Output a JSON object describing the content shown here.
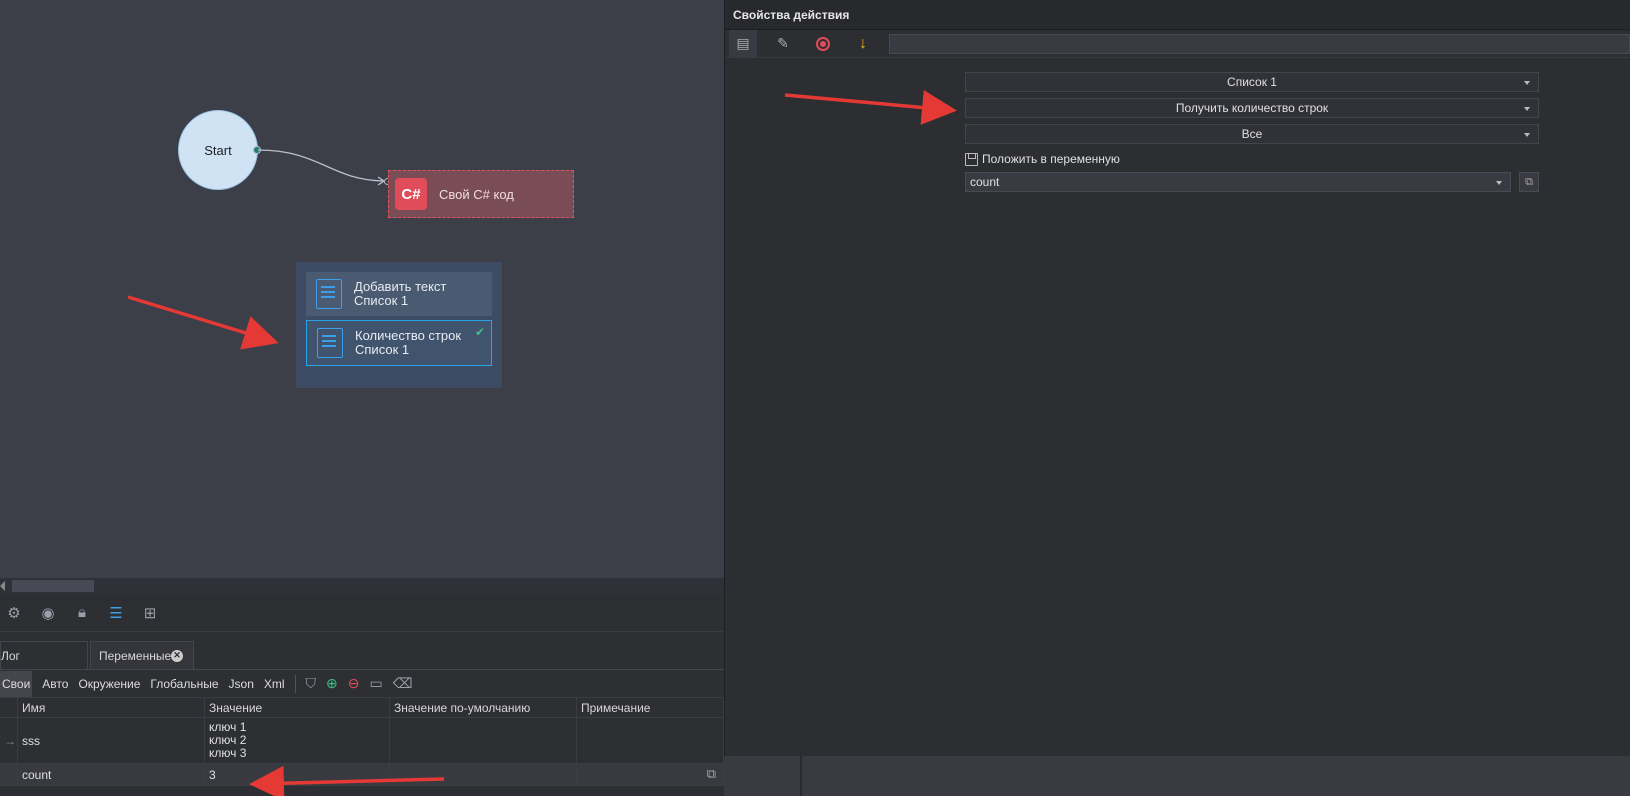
{
  "canvas": {
    "start_label": "Start",
    "cs_badge": "C#",
    "cs_label": "Свой C# код",
    "group_items": [
      {
        "line1": "Добавить текст",
        "line2": "Список 1",
        "selected": false
      },
      {
        "line1": "Количество строк",
        "line2": "Список 1",
        "selected": true
      }
    ]
  },
  "bottom": {
    "icons": [
      "gear-icon",
      "user-icon",
      "lock-icon",
      "list-icon",
      "add-frame-icon"
    ],
    "tabs": [
      {
        "label": "Лог"
      },
      {
        "label": "Переменные"
      }
    ],
    "subtabs": [
      "Свои",
      "Авто",
      "Окружение",
      "Глобальные",
      "Json",
      "Xml"
    ],
    "columns": [
      "Имя",
      "Значение",
      "Значение по-умолчанию",
      "Примечание"
    ],
    "rows": [
      {
        "name": "sss",
        "value_lines": [
          "ключ 1",
          "ключ 2",
          "ключ 3"
        ],
        "default": "",
        "note": ""
      },
      {
        "name": "count",
        "value": "3",
        "default": "",
        "note": ""
      }
    ]
  },
  "panel": {
    "title": "Свойства действия",
    "list_select": "Список 1",
    "operation_select": "Получить количество строк",
    "scope_select": "Все",
    "checkbox_label": "Положить в переменную",
    "variable_value": "count"
  },
  "colors": {
    "accent": "#2aa2e8",
    "danger": "#e04c5a",
    "arrow": "#e53935"
  }
}
